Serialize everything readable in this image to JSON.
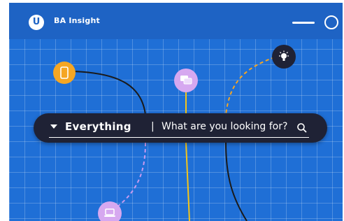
{
  "header": {
    "logo_letter": "U",
    "brand": "BA Insight"
  },
  "search": {
    "scope": "Everything",
    "divider": "|",
    "placeholder": "What are you looking for?"
  },
  "icons": [
    "phone-icon",
    "chat-icon",
    "lightbulb-icon",
    "laptop-icon",
    "search-icon",
    "menu-icon",
    "circle-icon",
    "caret-down-icon"
  ],
  "colors": {
    "background": "#1f6fd6",
    "header": "#1e63c4",
    "search_bar": "#1f2235",
    "orange_node": "#f5a623",
    "purple_node": "#d6a8f0",
    "dark_node": "#1f2235",
    "dashed_purple": "#c79bf0",
    "dashed_orange": "#f5a623",
    "yellow_line": "#f5c518"
  }
}
